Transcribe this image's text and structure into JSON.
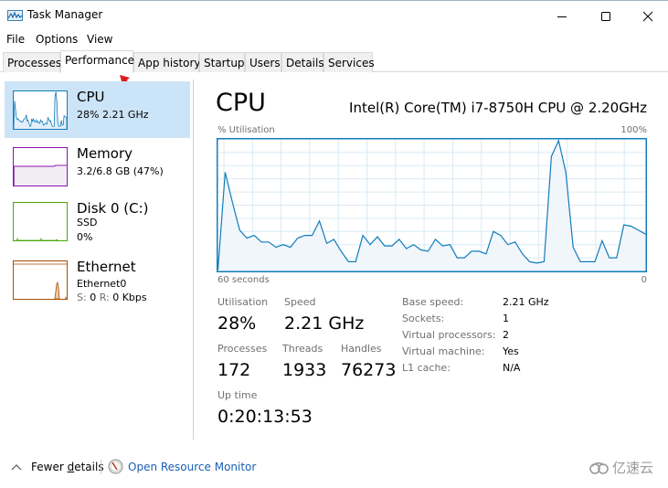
{
  "window": {
    "title": "Task Manager",
    "icon": "task-manager-icon",
    "controls": [
      "minimize-icon",
      "maximize-icon",
      "close-icon"
    ]
  },
  "menu": [
    "File",
    "Options",
    "View"
  ],
  "tabs": [
    {
      "label": "Processes",
      "active": false
    },
    {
      "label": "Performance",
      "active": true
    },
    {
      "label": "App history",
      "active": false
    },
    {
      "label": "Startup",
      "active": false
    },
    {
      "label": "Users",
      "active": false
    },
    {
      "label": "Details",
      "active": false
    },
    {
      "label": "Services",
      "active": false
    }
  ],
  "sidebar": {
    "items": [
      {
        "name": "CPU",
        "line1": "28%  2.21 GHz",
        "line2": "",
        "color": "#117dbb",
        "active": true
      },
      {
        "name": "Memory",
        "line1": "3.2/6.8 GB (47%)",
        "line2": "",
        "color": "#8b12ae",
        "active": false
      },
      {
        "name": "Disk 0 (C:)",
        "line1": "SSD",
        "line2": "0%",
        "color": "#4da60c",
        "active": false
      },
      {
        "name": "Ethernet",
        "line1": "Ethernet0",
        "line2_s_label": "S:",
        "line2_s_val": "0",
        "line2_r_label": "R:",
        "line2_r_val": "0 Kbps",
        "color": "#a74f01",
        "active": false
      }
    ]
  },
  "main": {
    "title": "CPU",
    "model": "Intel(R) Core(TM) i7-8750H CPU @ 2.20GHz",
    "graph_label_tl": "% Utilisation",
    "graph_label_tr": "100%",
    "graph_label_bl": "60 seconds",
    "graph_label_br": "0",
    "stats": {
      "utilisation_label": "Utilisation",
      "utilisation": "28%",
      "speed_label": "Speed",
      "speed": "2.21 GHz",
      "processes_label": "Processes",
      "processes": "172",
      "threads_label": "Threads",
      "threads": "1933",
      "handles_label": "Handles",
      "handles": "76273",
      "uptime_label": "Up time",
      "uptime": "0:20:13:53"
    },
    "details": [
      {
        "label": "Base speed:",
        "value": "2.21 GHz"
      },
      {
        "label": "Sockets:",
        "value": "1"
      },
      {
        "label": "Virtual processors:",
        "value": "2"
      },
      {
        "label": "Virtual machine:",
        "value": "Yes"
      },
      {
        "label": "L1 cache:",
        "value": "N/A"
      }
    ]
  },
  "footer": {
    "fewer_details_pre": "Fewer ",
    "fewer_details_u": "d",
    "fewer_details_post": "etails",
    "open_resource_monitor": "Open Resource Monitor"
  },
  "watermark": "亿速云",
  "chart_data": {
    "type": "area",
    "title": "CPU % Utilisation",
    "xlabel": "60 seconds",
    "ylabel": "% Utilisation",
    "ylim": [
      0,
      100
    ],
    "xlim": [
      60,
      0
    ],
    "grid": true,
    "color": "#117dbb",
    "values": [
      1,
      75,
      52,
      31,
      25,
      27,
      22,
      22,
      18,
      20,
      18,
      25,
      27,
      27,
      38,
      21,
      24,
      15,
      7,
      7,
      27,
      20,
      26,
      19,
      19,
      24,
      17,
      20,
      16,
      15,
      24,
      19,
      20,
      10,
      10,
      15,
      15,
      13,
      30,
      27,
      20,
      22,
      13,
      7,
      6,
      7,
      87,
      99,
      75,
      18,
      7,
      7,
      7,
      23,
      10,
      10,
      35,
      34,
      31,
      28
    ]
  }
}
